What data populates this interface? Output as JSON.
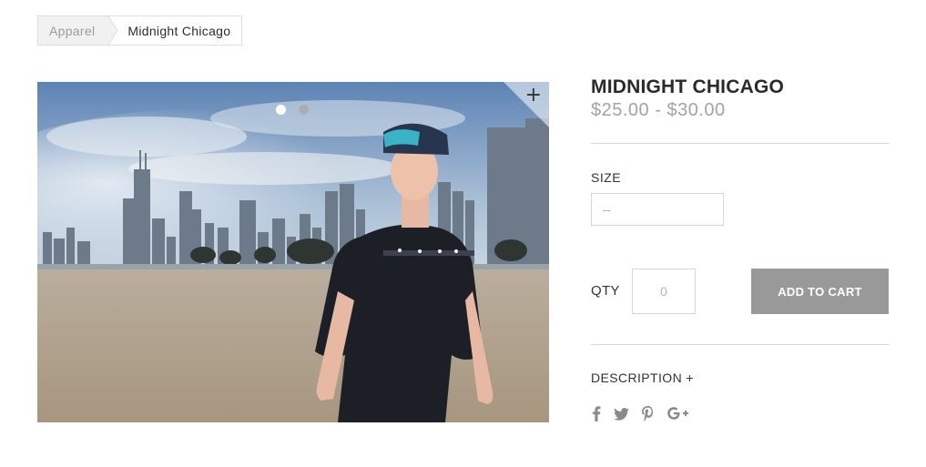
{
  "breadcrumb": {
    "parent": "Apparel",
    "current": "Midnight Chicago"
  },
  "gallery": {
    "slide_count": 2,
    "active_slide": 1,
    "zoom_symbol": "+"
  },
  "product": {
    "title": "MIDNIGHT CHICAGO",
    "price": "$25.00 - $30.00",
    "size_label": "SIZE",
    "size_selected": "--",
    "qty_label": "QTY",
    "qty_placeholder": "0",
    "add_to_cart_label": "ADD TO CART",
    "description_label": "DESCRIPTION +"
  },
  "social": {
    "icons": [
      "facebook-icon",
      "twitter-icon",
      "pinterest-icon",
      "google-plus-icon"
    ],
    "google_plus_text": "G+"
  },
  "colors": {
    "button_bg": "#999999",
    "price": "#a3a3a3",
    "divider": "#d8d8d8",
    "icon": "#8a8a8a"
  }
}
